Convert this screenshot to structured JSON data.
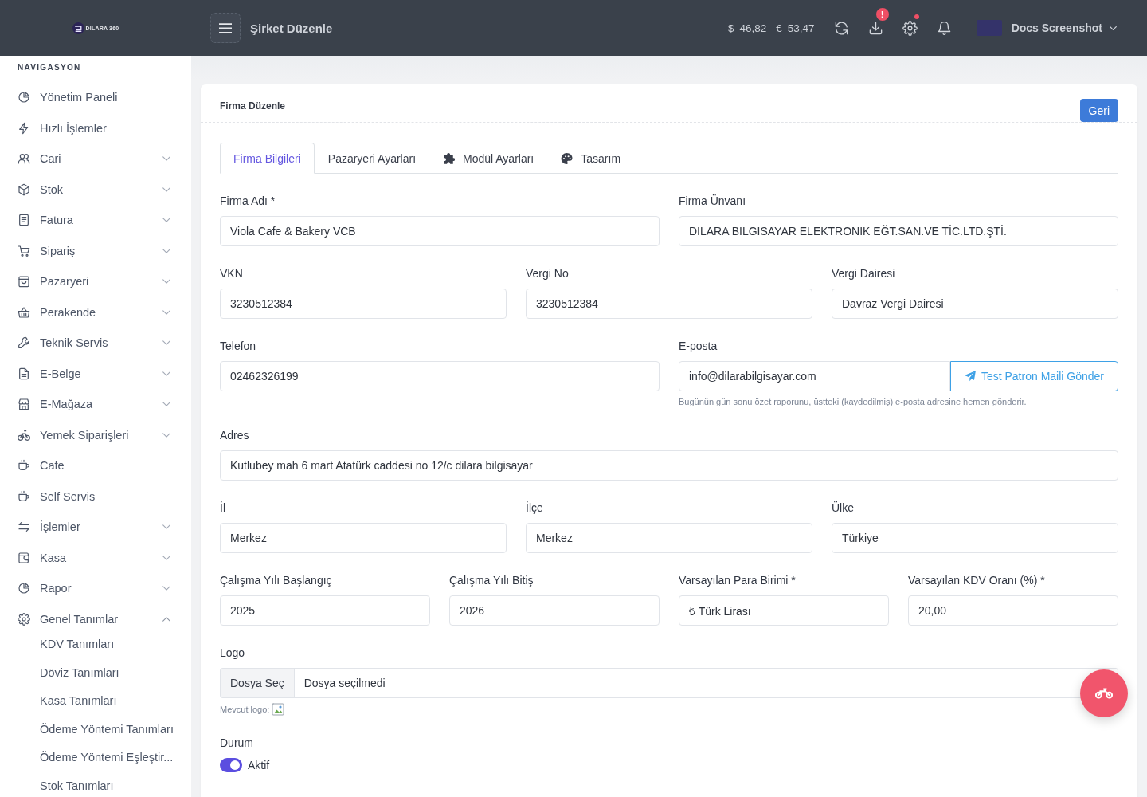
{
  "topbar": {
    "logo_text": "DILARA 360",
    "title": "Şirket Düzenle",
    "rates": [
      {
        "symbol": "$",
        "value": "46,82"
      },
      {
        "symbol": "€",
        "value": "53,47"
      }
    ],
    "actions": [
      {
        "kind": "refresh",
        "dot": false
      },
      {
        "kind": "download",
        "badge": "!",
        "dot": false
      },
      {
        "kind": "settings",
        "dot": true
      },
      {
        "kind": "notifications",
        "dot": false
      }
    ],
    "user": {
      "name": "Docs Screenshot"
    }
  },
  "sidebar": {
    "heading": "NAVIGASYON",
    "items": [
      {
        "label": "Yönetim Paneli",
        "submenu": false
      },
      {
        "label": "Hızlı İşlemler",
        "submenu": false
      },
      {
        "label": "Cari",
        "submenu": true,
        "expanded": false
      },
      {
        "label": "Stok",
        "submenu": true,
        "expanded": false
      },
      {
        "label": "Fatura",
        "submenu": true,
        "expanded": false
      },
      {
        "label": "Sipariş",
        "submenu": true,
        "expanded": false
      },
      {
        "label": "Pazaryeri",
        "submenu": true,
        "expanded": false
      },
      {
        "label": "Perakende",
        "submenu": true,
        "expanded": false
      },
      {
        "label": "Teknik Servis",
        "submenu": true,
        "expanded": false
      },
      {
        "label": "E-Belge",
        "submenu": true,
        "expanded": false
      },
      {
        "label": "E-Mağaza",
        "submenu": true,
        "expanded": false
      },
      {
        "label": "Yemek Siparişleri",
        "submenu": true,
        "expanded": false
      },
      {
        "label": "Cafe",
        "submenu": false
      },
      {
        "label": "Self Servis",
        "submenu": false
      },
      {
        "label": "İşlemler",
        "submenu": true,
        "expanded": false
      },
      {
        "label": "Kasa",
        "submenu": true,
        "expanded": false
      },
      {
        "label": "Rapor",
        "submenu": true,
        "expanded": false
      },
      {
        "label": "Genel Tanımlar",
        "submenu": true,
        "expanded": true,
        "children": [
          {
            "label": "KDV Tanımları"
          },
          {
            "label": "Döviz Tanımları"
          },
          {
            "label": "Kasa Tanımları"
          },
          {
            "label": "Ödeme Yöntemi Tanımları"
          },
          {
            "label": "Ödeme Yöntemi Eşleştir..."
          },
          {
            "label": "Stok Tanımları"
          }
        ]
      }
    ]
  },
  "card": {
    "title": "Firma Düzenle",
    "back_button": "Geri",
    "tabs": [
      {
        "label": "Firma Bilgileri",
        "selected": true
      },
      {
        "label": "Pazaryeri Ayarları",
        "selected": false
      },
      {
        "label": "Modül Ayarları",
        "selected": false
      },
      {
        "label": "Tasarım",
        "selected": false
      }
    ],
    "form": {
      "rows": [
        {
          "fields": [
            {
              "kind": "text",
              "label": "Firma Adı *",
              "value": "Viola Cafe & Bakery VCB"
            },
            {
              "kind": "text",
              "label": "Firma Ünvanı",
              "value": "DILARA BILGISAYAR ELEKTRONIK EĞT.SAN.VE TİC.LTD.ŞTİ."
            }
          ]
        },
        {
          "fields": [
            {
              "kind": "text",
              "label": "VKN",
              "value": "3230512384"
            },
            {
              "kind": "text",
              "label": "Vergi No",
              "value": "3230512384"
            },
            {
              "kind": "text",
              "label": "Vergi Dairesi",
              "value": "Davraz Vergi Dairesi"
            }
          ]
        },
        {
          "fields": [
            {
              "kind": "text",
              "label": "Telefon",
              "value": "02462326199"
            },
            {
              "kind": "email_action",
              "label": "E-posta",
              "value": "info@dilarabilgisayar.com",
              "button": "Test Patron Maili Gönder",
              "hint": "Bugünün gün sonu özet raporunu, üstteki (kaydedilmiş) e-posta adresine hemen gönderir."
            }
          ]
        },
        {
          "fields": [
            {
              "kind": "text",
              "label": "Adres",
              "value": "Kutlubey mah 6 mart Atatürk caddesi no 12/c dilara bilgisayar"
            }
          ]
        },
        {
          "fields": [
            {
              "kind": "text",
              "label": "İl",
              "value": "Merkez"
            },
            {
              "kind": "text",
              "label": "İlçe",
              "value": "Merkez"
            },
            {
              "kind": "text",
              "label": "Ülke",
              "value": "Türkiye"
            }
          ]
        },
        {
          "fields": [
            {
              "kind": "text",
              "label": "Çalışma Yılı Başlangıç",
              "value": "2025"
            },
            {
              "kind": "text",
              "label": "Çalışma Yılı Bitiş",
              "value": "2026"
            },
            {
              "kind": "text",
              "label": "Varsayılan Para Birimi *",
              "value": "₺ Türk Lirası"
            },
            {
              "kind": "text",
              "label": "Varsayılan KDV Oranı (%) *",
              "value": "20,00"
            }
          ]
        },
        {
          "fields": [
            {
              "kind": "file",
              "label": "Logo",
              "button": "Dosya Seç",
              "value": "Dosya seçilmedi",
              "note": "Mevcut logo:"
            }
          ]
        },
        {
          "fields": [
            {
              "kind": "switch",
              "label": "Durum",
              "on": true,
              "text": "Aktif"
            }
          ]
        }
      ]
    }
  }
}
